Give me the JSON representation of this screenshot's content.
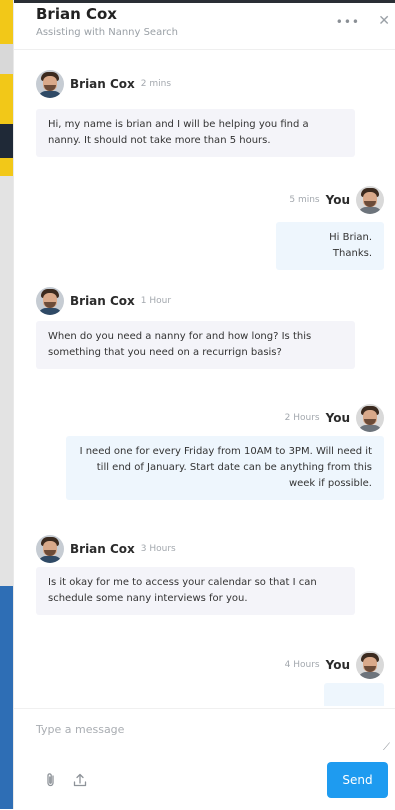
{
  "header": {
    "name": "Brian Cox",
    "subtitle": "Assisting with Nanny Search",
    "more_icon": "more-horizontal-icon",
    "close_icon": "close-icon"
  },
  "messages": [
    {
      "sender": "Brian Cox",
      "time": "2 mins",
      "direction": "in",
      "text": "Hi, my name is brian and I will be helping you find a nanny. It should not take more than 5 hours."
    },
    {
      "sender": "You",
      "time": "5 mins",
      "direction": "out",
      "text": "Hi Brian. Thanks."
    },
    {
      "sender": "Brian Cox",
      "time": "1 Hour",
      "direction": "in",
      "text": "When do you need a nanny for and how long? Is this something that you need on a recurrign basis?"
    },
    {
      "sender": "You",
      "time": "2 Hours",
      "direction": "out",
      "text": "I need one for every Friday from 10AM to 3PM. Will need it till end of January. Start date can be anything from this week if possible."
    },
    {
      "sender": "Brian Cox",
      "time": "3 Hours",
      "direction": "in",
      "text": "Is it okay for me to access your calendar so that I can schedule some nany interviews for you."
    },
    {
      "sender": "You",
      "time": "4 Hours",
      "direction": "out",
      "text": ""
    }
  ],
  "composer": {
    "placeholder": "Type a message",
    "value": "",
    "send_label": "Send",
    "attach_icon": "paperclip-icon",
    "upload_icon": "upload-icon"
  },
  "colors": {
    "accent": "#1e9bf0",
    "incoming_bubble": "#f4f4f9",
    "outgoing_bubble": "#eef6fd"
  }
}
